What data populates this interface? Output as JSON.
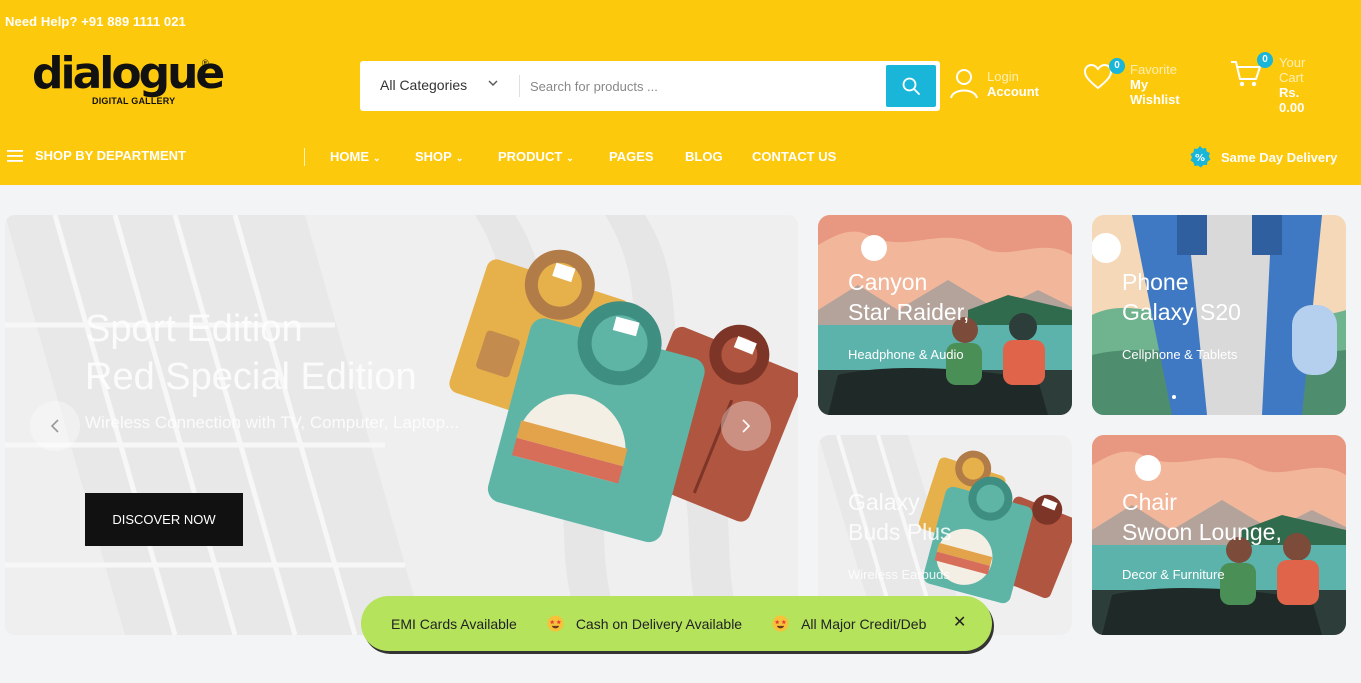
{
  "header": {
    "help_text": "Need Help? +91 889 1111 021",
    "logo_word": "dialogue",
    "logo_tagline": "DIGITAL GALLERY",
    "logo_reg": "®",
    "search": {
      "category_label": "All Categories",
      "placeholder": "Search for products ..."
    },
    "account": {
      "small": "Login",
      "big": "Account"
    },
    "wishlist": {
      "count": "0",
      "small": "Favorite",
      "big_line1": "My",
      "big_line2": "Wishlist"
    },
    "cart": {
      "count": "0",
      "small_line1": "Your",
      "small_line2": "Cart",
      "total_line1": "Rs.",
      "total_line2": "0.00"
    }
  },
  "nav": {
    "department_label": "SHOP BY DEPARTMENT",
    "items": [
      {
        "label": "HOME",
        "dropdown": true
      },
      {
        "label": "SHOP",
        "dropdown": true
      },
      {
        "label": "PRODUCT",
        "dropdown": true
      },
      {
        "label": "PAGES",
        "dropdown": false
      },
      {
        "label": "BLOG",
        "dropdown": false
      },
      {
        "label": "CONTACT US",
        "dropdown": false
      }
    ],
    "delivery_label": "Same Day Delivery"
  },
  "hero": {
    "title_line1": "Sport Edition",
    "title_line2": "Red Special Edition",
    "subtitle": "Wireless Connection with TV, Computer, Laptop...",
    "button_label": "DISCOVER NOW"
  },
  "promo_cards": [
    {
      "title_line1": "Canyon",
      "title_line2": "Star Raider,",
      "category": "Headphone & Audio"
    },
    {
      "title_line1": "Phone",
      "title_line2": "Galaxy S20",
      "category": "Cellphone & Tablets"
    },
    {
      "title_line1": "Galaxy",
      "title_line2": "Buds Plus",
      "category": "Wireless Earbuds"
    },
    {
      "title_line1": "Chair",
      "title_line2": "Swoon Lounge,",
      "category": "Decor & Furniture"
    }
  ],
  "ticker": {
    "items": [
      "EMI Cards Available",
      "Cash on Delivery Available",
      "All Major Credit/Deb"
    ],
    "close_label": "✕"
  },
  "colors": {
    "brand_yellow": "#fdc90d",
    "accent_cyan": "#19b6d9",
    "ticker_green": "#b5e35c"
  }
}
